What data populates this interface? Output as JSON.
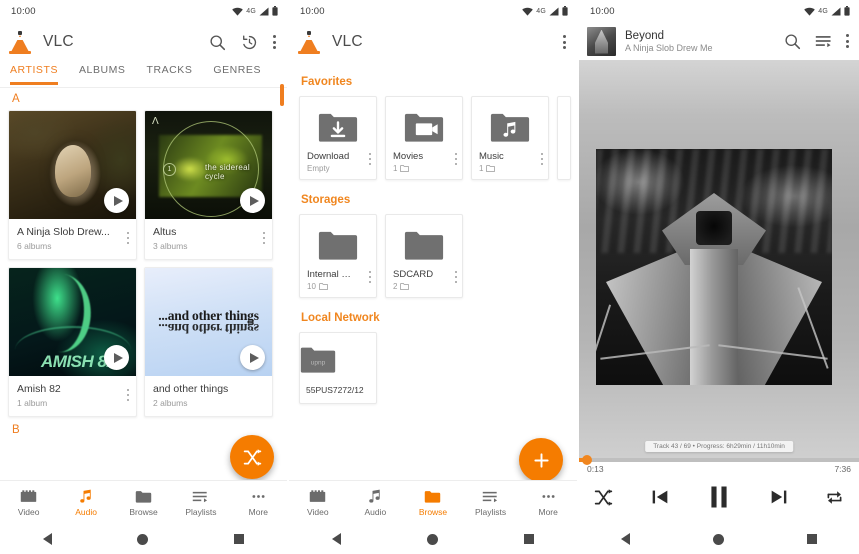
{
  "meta": {
    "accent": "#f57c00",
    "accent_text": "#ef7e20",
    "status_text_color": "#3a3a3a"
  },
  "status_bar": {
    "clock": "10:00",
    "network": "4G"
  },
  "panel_artists": {
    "app_title": "VLC",
    "actions": {
      "search": "search-icon",
      "history": "history-icon",
      "overflow": "overflow-menu-icon"
    },
    "tabs": [
      {
        "label": "ARTISTS",
        "active": true
      },
      {
        "label": "ALBUMS",
        "active": false
      },
      {
        "label": "TRACKS",
        "active": false
      },
      {
        "label": "GENRES",
        "active": false
      }
    ],
    "section_letter_a": "A",
    "section_letter_b": "B",
    "cards": [
      {
        "title": "A Ninja Slob Drew...",
        "subtitle": "6 albums"
      },
      {
        "title": "Altus",
        "subtitle": "3 albums",
        "art_caption": "the sidereal cycle",
        "art_badge": "1"
      },
      {
        "title": "Amish 82",
        "subtitle": "1 album",
        "art_caption": "AMISH 82"
      },
      {
        "title": "and other things",
        "subtitle": "2 albums",
        "art_caption": "...and other things"
      }
    ],
    "fab": "shuffle-icon",
    "bottom_nav": [
      {
        "label": "Video",
        "icon": "video-icon",
        "active": false
      },
      {
        "label": "Audio",
        "icon": "music-note-icon",
        "active": true
      },
      {
        "label": "Browse",
        "icon": "folder-icon",
        "active": false
      },
      {
        "label": "Playlists",
        "icon": "playlist-icon",
        "active": false
      },
      {
        "label": "More",
        "icon": "more-icon",
        "active": false
      }
    ]
  },
  "panel_browse": {
    "app_title": "VLC",
    "actions": {
      "overflow": "overflow-menu-icon"
    },
    "sections": [
      {
        "heading": "Favorites",
        "items": [
          {
            "name": "Download",
            "sub": "Empty",
            "icon": "folder-download-icon",
            "has_count_icon": false
          },
          {
            "name": "Movies",
            "sub": "1",
            "icon": "folder-movie-icon",
            "has_count_icon": true
          },
          {
            "name": "Music",
            "sub": "1",
            "icon": "folder-music-icon",
            "has_count_icon": true
          }
        ]
      },
      {
        "heading": "Storages",
        "items": [
          {
            "name": "Internal m...",
            "sub": "10",
            "icon": "folder-icon",
            "has_count_icon": true
          },
          {
            "name": "SDCARD",
            "sub": "2",
            "icon": "folder-icon",
            "has_count_icon": true
          }
        ]
      },
      {
        "heading": "Local Network",
        "items": [
          {
            "name": "55PUS7272/12",
            "sub": "",
            "icon": "folder-network-icon",
            "icon_label": "upnp",
            "has_count_icon": false
          }
        ]
      }
    ],
    "fab": "add-icon",
    "bottom_nav": [
      {
        "label": "Video",
        "icon": "video-icon",
        "active": false
      },
      {
        "label": "Audio",
        "icon": "music-note-icon",
        "active": false
      },
      {
        "label": "Browse",
        "icon": "folder-icon",
        "active": true
      },
      {
        "label": "Playlists",
        "icon": "playlist-icon",
        "active": false
      },
      {
        "label": "More",
        "icon": "more-icon",
        "active": false
      }
    ]
  },
  "panel_player": {
    "track_title": "Beyond",
    "track_artist": "A Ninja Slob Drew Me",
    "actions": {
      "search": "search-icon",
      "playlist": "playlist-queue-icon",
      "overflow": "overflow-menu-icon"
    },
    "toast": "Track 43 / 69 • Progress: 6h29min / 11h10min",
    "time_current": "0:13",
    "time_total": "7:36",
    "progress_percent": 3,
    "controls": [
      {
        "name": "shuffle",
        "icon": "shuffle-icon"
      },
      {
        "name": "previous",
        "icon": "skip-previous-icon"
      },
      {
        "name": "play-pause",
        "icon": "pause-icon"
      },
      {
        "name": "next",
        "icon": "skip-next-icon"
      },
      {
        "name": "repeat",
        "icon": "repeat-icon"
      }
    ]
  }
}
